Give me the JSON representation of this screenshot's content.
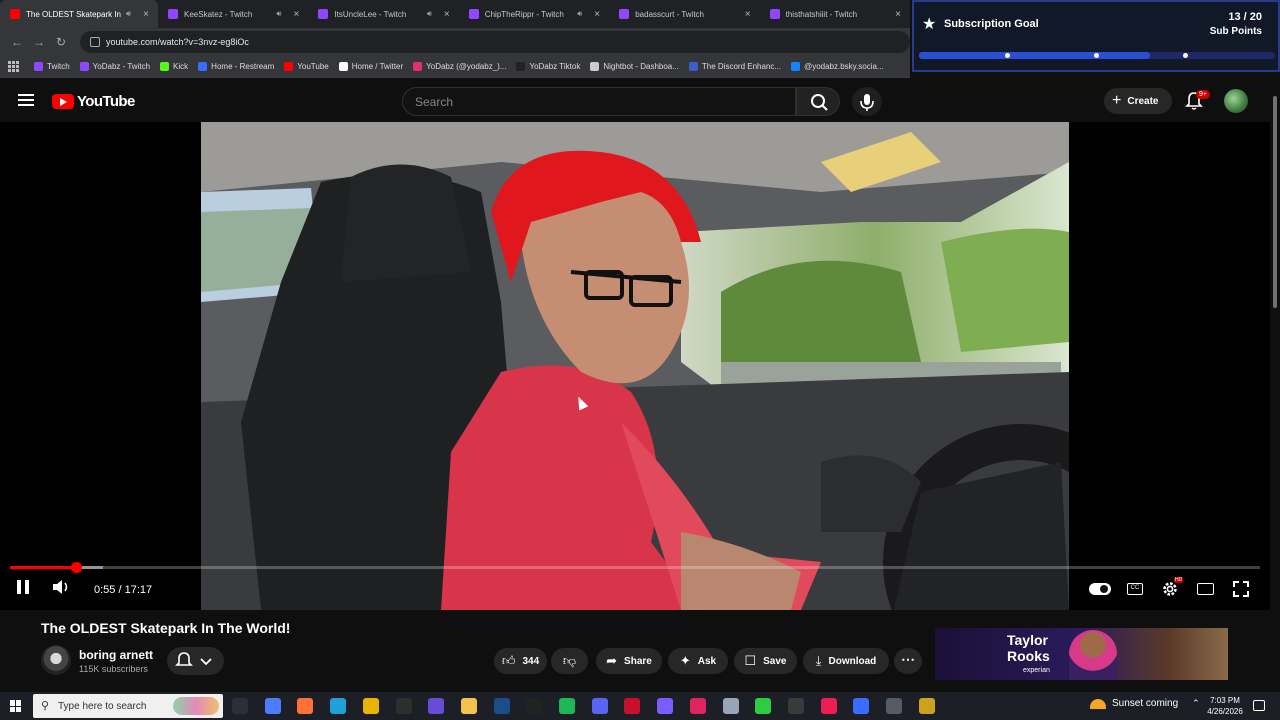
{
  "browser": {
    "tabs": [
      {
        "title": "The OLDEST Skatepark In The W",
        "favicon_color": "#ff0000",
        "audio": true,
        "active": true
      },
      {
        "title": "KeeSkatez - Twitch",
        "favicon_color": "#9146ff",
        "audio": true,
        "active": false
      },
      {
        "title": "ItsUncleLee - Twitch",
        "favicon_color": "#9146ff",
        "audio": true,
        "active": false
      },
      {
        "title": "ChipTheRippr - Twitch",
        "favicon_color": "#9146ff",
        "audio": true,
        "active": false
      },
      {
        "title": "badasscurt - Twitch",
        "favicon_color": "#9146ff",
        "audio": false,
        "active": false
      },
      {
        "title": "thisthatshiiit - Twitch",
        "favicon_color": "#9146ff",
        "audio": false,
        "active": false
      }
    ],
    "url": "youtube.com/watch?v=3nvz-eg8iOc",
    "bookmarks": [
      {
        "label": "Twitch",
        "color": "#9146ff"
      },
      {
        "label": "YoDabz - Twitch",
        "color": "#9146ff"
      },
      {
        "label": "Kick",
        "color": "#53fc18"
      },
      {
        "label": "Home - Restream",
        "color": "#3b6cff"
      },
      {
        "label": "YouTube",
        "color": "#ff0000"
      },
      {
        "label": "Home / Twitter",
        "color": "#ffffff"
      },
      {
        "label": "YoDabz (@yodabz_)...",
        "color": "#e1306c"
      },
      {
        "label": "YoDabz Tiktok",
        "color": "#222222"
      },
      {
        "label": "Nightbot - Dashboa...",
        "color": "#cccccc"
      },
      {
        "label": "The Discord Enhanc...",
        "color": "#3a5fcd"
      },
      {
        "label": "@yodabz.bsky.socia...",
        "color": "#1185fe"
      }
    ]
  },
  "goal": {
    "label": "Subscription Goal",
    "count": "13 / 20",
    "unit": "Sub Points",
    "progress": 0.65
  },
  "youtube": {
    "wordmark": "YouTube",
    "search_placeholder": "Search",
    "create_label": "Create",
    "notif_badge": "9+"
  },
  "player": {
    "time": "0:55 / 17:17",
    "played_fraction": 0.053,
    "buffered_fraction": 0.074
  },
  "video": {
    "title": "The OLDEST Skatepark In The World!",
    "channel": "boring arnett",
    "subscribers": "115K subscribers",
    "likes": "344",
    "share_label": "Share",
    "ask_label": "Ask",
    "save_label": "Save",
    "download_label": "Download"
  },
  "ad": {
    "line1": "Taylor",
    "line2": "Rooks",
    "sponsor": "experian"
  },
  "taskbar": {
    "search_placeholder": "Type here to search",
    "weather": "Sunset coming",
    "time": "7:03 PM",
    "date": "4/26/2026",
    "icons": [
      {
        "name": "task-view-icon",
        "color": "#2b2f38"
      },
      {
        "name": "copilot-icon",
        "color": "#4f7bff"
      },
      {
        "name": "firefox-icon",
        "color": "#ff7139"
      },
      {
        "name": "edge-icon",
        "color": "#1fa0d8"
      },
      {
        "name": "chrome-icon",
        "color": "#e8b400"
      },
      {
        "name": "obs-icon",
        "color": "#2e2e2e"
      },
      {
        "name": "app-spiral-icon",
        "color": "#6a4bd8"
      },
      {
        "name": "file-explorer-icon",
        "color": "#f2c14e"
      },
      {
        "name": "steam-icon",
        "color": "#1b4d8a"
      },
      {
        "name": "epic-games-icon",
        "color": "#222222"
      },
      {
        "name": "spotify-icon",
        "color": "#1db954"
      },
      {
        "name": "discord-icon",
        "color": "#5865f2"
      },
      {
        "name": "app-red-icon",
        "color": "#c8102e"
      },
      {
        "name": "feather-icon",
        "color": "#7b5cff"
      },
      {
        "name": "app-target-icon",
        "color": "#e0245e"
      },
      {
        "name": "app-window-icon",
        "color": "#9aa4b8"
      },
      {
        "name": "app-green-icon",
        "color": "#2ecc40"
      },
      {
        "name": "app-ring-icon",
        "color": "#3a3a3a"
      },
      {
        "name": "tiktok-icon",
        "color": "#ee1d52"
      },
      {
        "name": "app-blue-icon",
        "color": "#3b6cff"
      },
      {
        "name": "settings-icon",
        "color": "#555a66"
      },
      {
        "name": "app-yellow-icon",
        "color": "#caa21c"
      }
    ]
  }
}
